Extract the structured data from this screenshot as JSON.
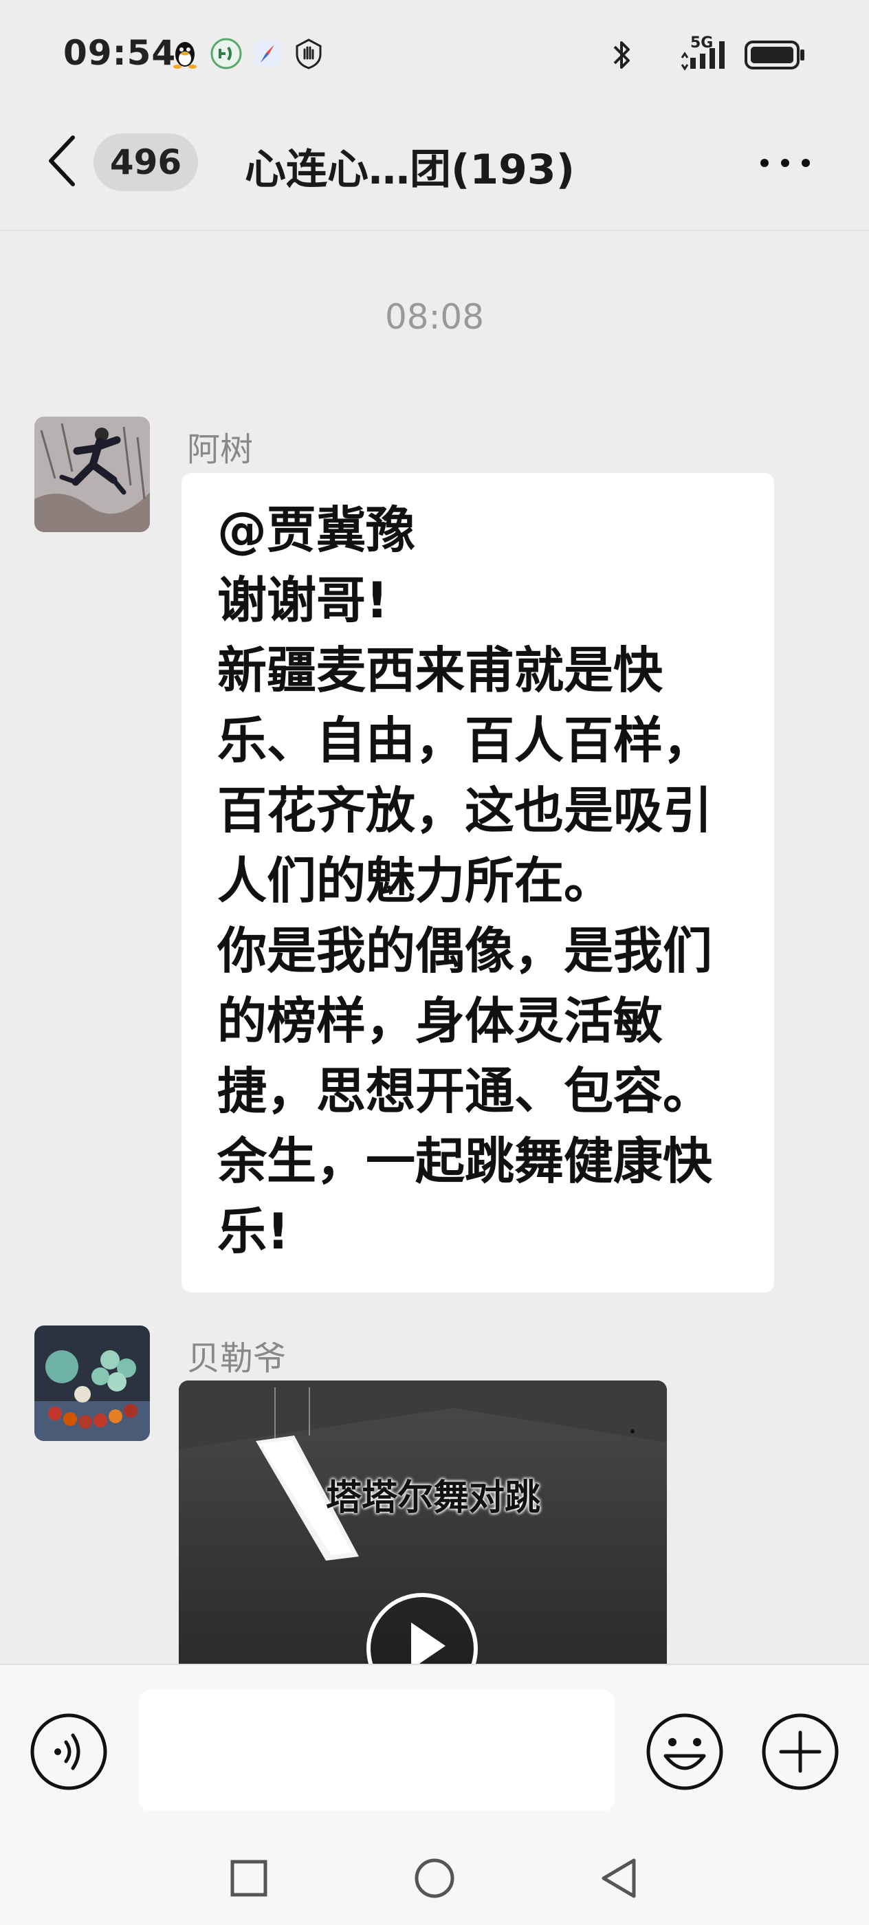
{
  "status_bar": {
    "time": "09:54",
    "left_icons": [
      "qq-penguin-icon",
      "wechat-mini-icon",
      "compass-icon",
      "hand-shield-icon"
    ],
    "network": "5G",
    "right_icons": [
      "bluetooth-icon",
      "signal-icon",
      "battery-icon"
    ]
  },
  "header": {
    "unread_count": "496",
    "title": "心连心…团(193)"
  },
  "chat": {
    "timestamp": "08:08",
    "messages": [
      {
        "sender": "阿树",
        "text": "@贾冀豫\n谢谢哥!\n新疆麦西来甫就是快\n乐、自由，百人百样，\n百花齐放，这也是吸引\n人们的魅力所在。\n你是我的偶像，是我们\n的榜样，身体灵活敏\n捷，思想开通、包容。\n余生，一起跳舞健康快\n乐!"
      },
      {
        "sender": "贝勒爷",
        "video_caption": "塔塔尔舞对跳"
      }
    ]
  },
  "input_bar": {
    "placeholder": ""
  },
  "colors": {
    "background": "#ededed",
    "bubble": "#ffffff",
    "badge": "#d8d8d8",
    "muted_text": "#888888"
  }
}
